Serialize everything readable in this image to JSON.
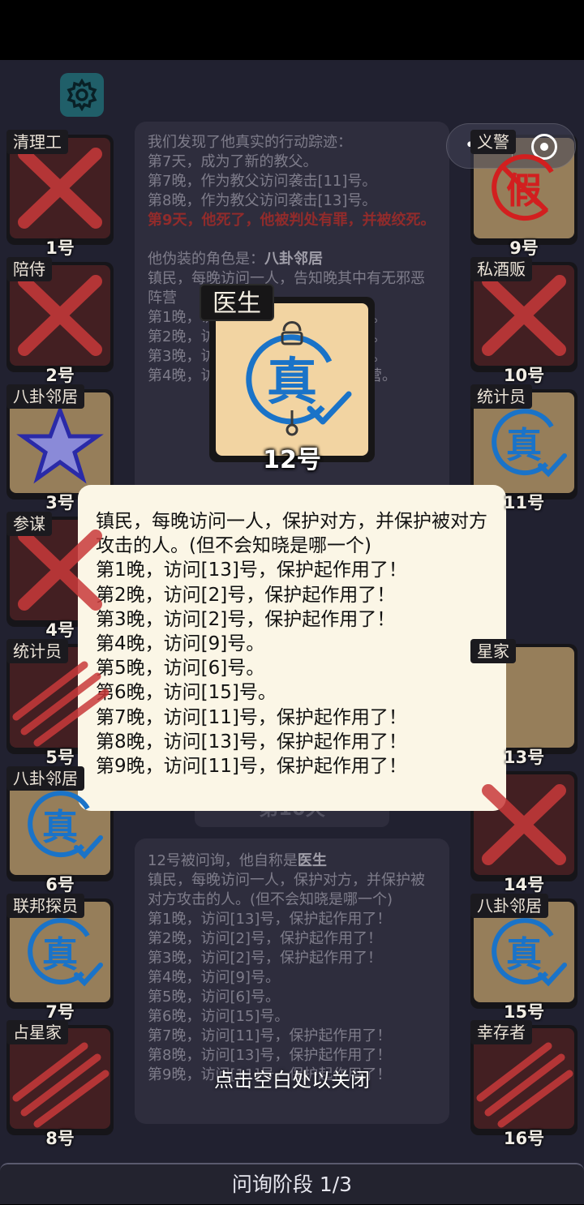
{
  "settings": {
    "icon": "gear-icon"
  },
  "mini_program_menu": {
    "more_icon": "•••",
    "close_icon": "target-icon"
  },
  "left_cards": [
    {
      "role": "清理工",
      "number": "1号",
      "status": "dead",
      "mark": "cross"
    },
    {
      "role": "陪侍",
      "number": "2号",
      "status": "dead",
      "mark": "cross"
    },
    {
      "role": "八卦邻居",
      "number": "3号",
      "status": "alive",
      "mark": "star"
    },
    {
      "role": "参谋",
      "number": "4号",
      "status": "dead",
      "mark": "cross"
    },
    {
      "role": "统计员",
      "number": "5号",
      "status": "dead",
      "mark": "claw"
    },
    {
      "role": "八卦邻居",
      "number": "6号",
      "status": "alive",
      "mark": "真"
    },
    {
      "role": "联邦探员",
      "number": "7号",
      "status": "alive",
      "mark": "真"
    },
    {
      "role": "占星家",
      "number": "8号",
      "status": "dead",
      "mark": "claw"
    }
  ],
  "right_cards": [
    {
      "role": "义警",
      "number": "9号",
      "status": "alive",
      "mark": "假"
    },
    {
      "role": "私酒贩",
      "number": "10号",
      "status": "dead",
      "mark": "cross"
    },
    {
      "role": "统计员",
      "number": "11号",
      "status": "alive",
      "mark": "真"
    },
    {
      "role": "星家",
      "number": "13号",
      "status": "alive",
      "mark": ""
    },
    {
      "role": "",
      "number": "14号",
      "status": "dead",
      "mark": "cross"
    },
    {
      "role": "八卦邻居",
      "number": "15号",
      "status": "alive",
      "mark": "真"
    },
    {
      "role": "幸存者",
      "number": "16号",
      "status": "dead",
      "mark": "claw"
    }
  ],
  "log_top": {
    "intro": "我们发现了他真实的行动踪迹：",
    "lines": [
      "第7天，成为了新的教父。",
      "第7晚，作为教父访问袭击[11]号。",
      "第8晚，作为教父访问袭击[13]号。"
    ],
    "death": "第9天，他死了，他被判处有罪，并被绞死。",
    "disguise_prefix": "他伪装的角色是：",
    "disguise_role": "八卦邻居",
    "disguise_lines": [
      "镇民，每晚访问一人，告知晚其中有无邪恶阵营",
      "第1晚，访问[...]号，存在邪恶阵营。",
      "第2晚，访问[...]号，存在邪恶阵营。",
      "第3晚，访问[...]号，存在邪恶阵营。",
      "第4晚，访问[7]号，不存在邪恶阵营。"
    ]
  },
  "day_label": "第10天",
  "log_bottom": {
    "prefix": "12号被问询，他自称是",
    "role": "医生",
    "desc": "镇民，每晚访问一人，保护对方，并保护被对方攻击的人。(但不会知晓是哪一个)",
    "lines": [
      "第1晚，访问[13]号，保护起作用了！",
      "第2晚，访问[2]号，保护起作用了！",
      "第3晚，访问[2]号，保护起作用了！",
      "第4晚，访问[9]号。",
      "第5晚，访问[6]号。",
      "第6晚，访问[15]号。",
      "第7晚，访问[11]号，保护起作用了！",
      "第8晚，访问[13]号，保护起作用了！",
      "第9晚，访问[11]号，保护起作用了！"
    ]
  },
  "focus_card": {
    "role": "医生",
    "number": "12号",
    "mark": "真"
  },
  "popup": {
    "desc": "镇民，每晚访问一人，保护对方，并保护被对方攻击的人。(但不会知晓是哪一个)",
    "lines": [
      "第1晚，访问[13]号，保护起作用了！",
      "第2晚，访问[2]号，保护起作用了！",
      "第3晚，访问[2]号，保护起作用了！",
      "第4晚，访问[9]号。",
      "第5晚，访问[6]号。",
      "第6晚，访问[15]号。",
      "第7晚，访问[11]号，保护起作用了！",
      "第8晚，访问[13]号，保护起作用了！",
      "第9晚，访问[11]号，保护起作用了！"
    ]
  },
  "close_hint": "点击空白处以关闭",
  "phase": "问询阶段 1/3",
  "colors": {
    "true_mark": "#1a73c8",
    "fake_mark": "#d21f1f",
    "death_text": "#c23a3a",
    "cross": "#c83a3a"
  }
}
